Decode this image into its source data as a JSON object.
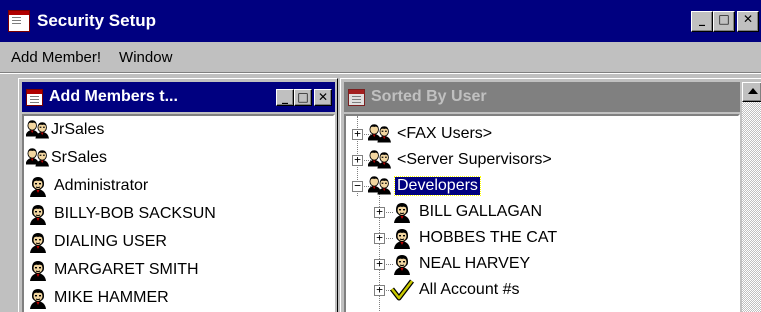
{
  "main_window": {
    "title": "Security Setup",
    "controls": {
      "minimize": "_",
      "maximize": "□",
      "close": "✕"
    }
  },
  "menu": {
    "items": [
      {
        "label": "Add Member!"
      },
      {
        "label": "Window"
      }
    ]
  },
  "left_child": {
    "title": "Add Members t...",
    "items": [
      {
        "label": "JrSales",
        "icon": "group-icon"
      },
      {
        "label": "SrSales",
        "icon": "group-icon"
      },
      {
        "label": "Administrator",
        "icon": "user-icon"
      },
      {
        "label": "BILLY-BOB SACKSUN",
        "icon": "user-icon"
      },
      {
        "label": "DIALING USER",
        "icon": "user-icon"
      },
      {
        "label": "MARGARET SMITH",
        "icon": "user-icon"
      },
      {
        "label": "MIKE HAMMER",
        "icon": "user-icon"
      }
    ]
  },
  "right_child": {
    "title": "Sorted By User",
    "tree": [
      {
        "label": "<FAX Users>",
        "icon": "group-icon",
        "expander": "+",
        "selected": false
      },
      {
        "label": "<Server Supervisors>",
        "icon": "group-icon",
        "expander": "+",
        "selected": false
      },
      {
        "label": "Developers",
        "icon": "group-icon",
        "expander": "−",
        "selected": true
      },
      {
        "label": "BILL GALLAGAN",
        "icon": "user-icon",
        "expander": "+",
        "selected": false
      },
      {
        "label": "HOBBES THE CAT",
        "icon": "user-icon",
        "expander": "+",
        "selected": false
      },
      {
        "label": "NEAL HARVEY",
        "icon": "user-icon",
        "expander": "+",
        "selected": false
      },
      {
        "label": "All Account #s",
        "icon": "checkmark-icon",
        "expander": "+",
        "selected": false
      }
    ]
  },
  "colors": {
    "active_title": "#000080",
    "inactive_title": "#808080",
    "face": "#c0c0c0",
    "selection": "#000080"
  }
}
